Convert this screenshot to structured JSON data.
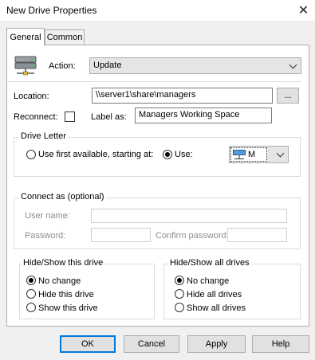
{
  "window": {
    "title": "New Drive Properties",
    "close_glyph": "✕"
  },
  "tabs": [
    {
      "label": "General",
      "active": true
    },
    {
      "label": "Common",
      "active": false
    }
  ],
  "action": {
    "label": "Action:",
    "value": "Update"
  },
  "location": {
    "label": "Location:",
    "value": "\\\\server1\\share\\managers",
    "browse_label": "..."
  },
  "reconnect": {
    "label": "Reconnect:",
    "checked": false
  },
  "label_as": {
    "label": "Label as:",
    "value": "Managers Working Space"
  },
  "drive_letter": {
    "title": "Drive Letter",
    "use_first_label": "Use first available, starting at:",
    "use_label": "Use:",
    "selected": "use",
    "letter": "M"
  },
  "connect_as": {
    "title": "Connect as (optional)",
    "username_label": "User name:",
    "password_label": "Password:",
    "confirm_label": "Confirm password:"
  },
  "hide_show_drive": {
    "title": "Hide/Show this drive",
    "options": [
      "No change",
      "Hide this drive",
      "Show this drive"
    ],
    "selected": 0
  },
  "hide_show_all": {
    "title": "Hide/Show all drives",
    "options": [
      "No change",
      "Hide all drives",
      "Show all drives"
    ],
    "selected": 0
  },
  "buttons": {
    "ok": "OK",
    "cancel": "Cancel",
    "apply": "Apply",
    "help": "Help"
  }
}
